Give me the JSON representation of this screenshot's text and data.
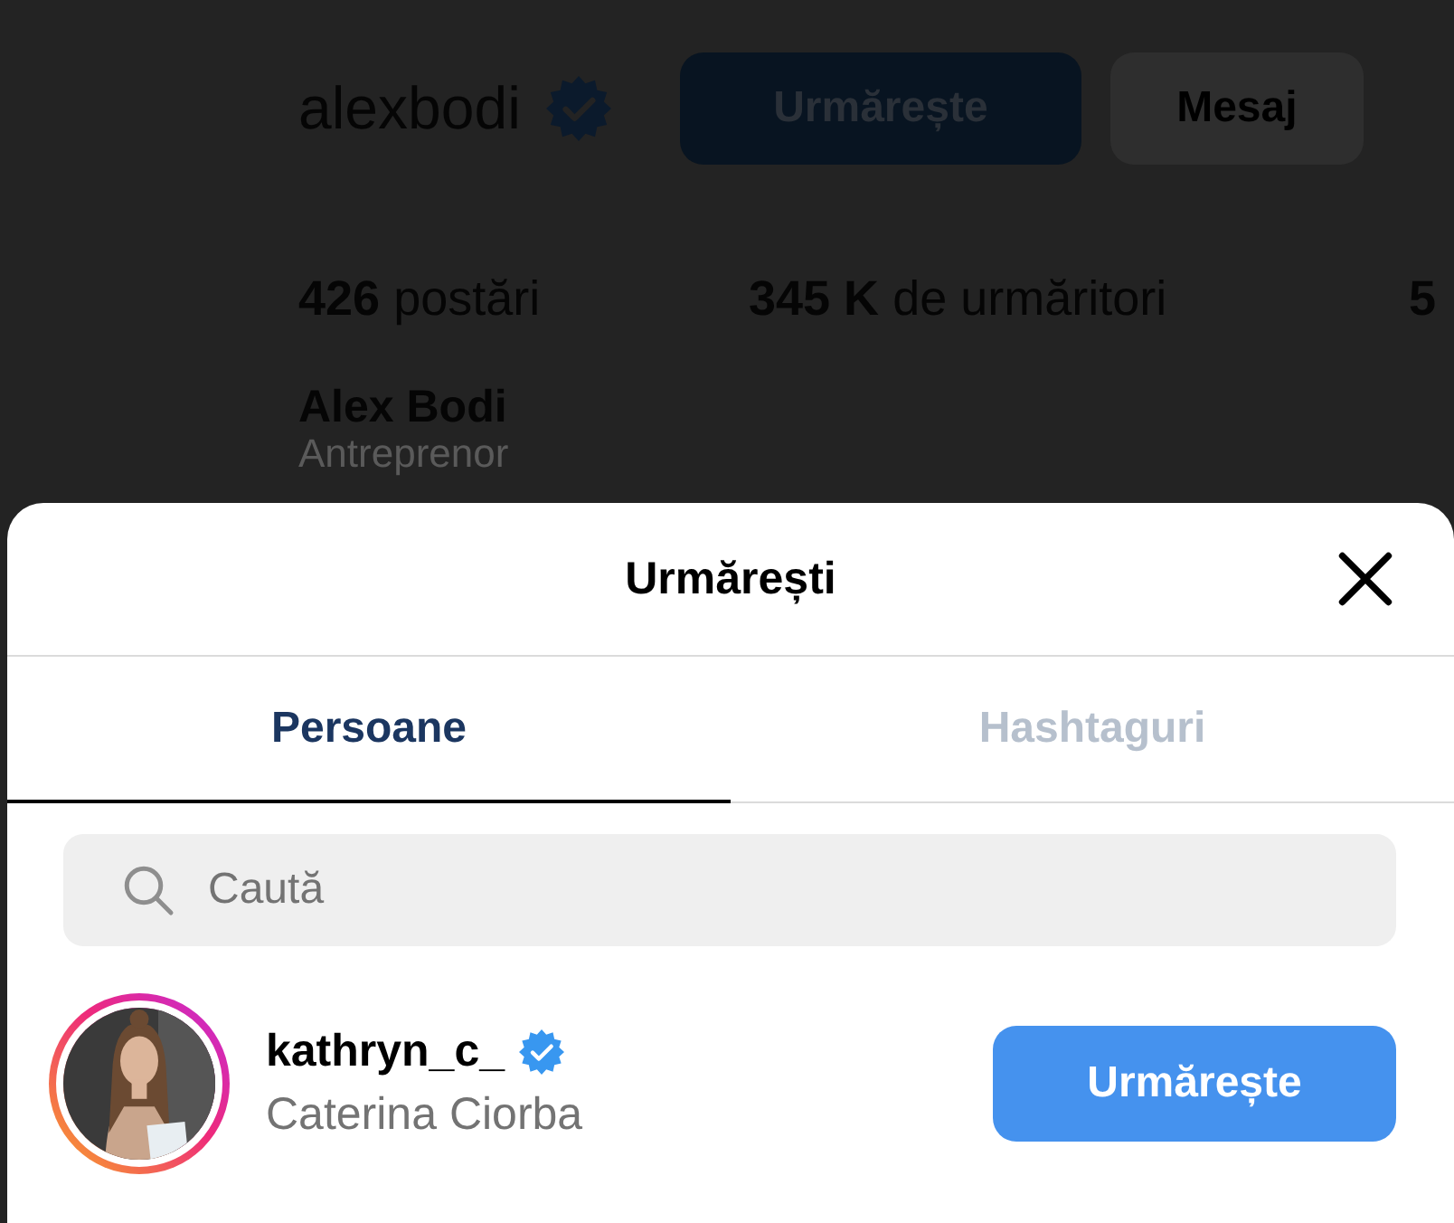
{
  "profile": {
    "username": "alexbodi",
    "verified": true,
    "follow_button": "Urmărește",
    "message_button": "Mesaj",
    "stats": [
      {
        "count": "426",
        "label": "postări"
      },
      {
        "count": "345 K",
        "label": "de urmăritori"
      },
      {
        "count": "5"
      }
    ],
    "full_name": "Alex Bodi",
    "bio": "Antreprenor"
  },
  "dialog": {
    "title": "Urmărești",
    "tabs": [
      {
        "label": "Persoane",
        "selected": true
      },
      {
        "label": "Hashtaguri",
        "selected": false
      }
    ],
    "search": {
      "placeholder": "Caută"
    },
    "accounts": [
      {
        "username": "kathryn_c_",
        "verified": true,
        "name": "Caterina Ciorba",
        "button": "Urmărește"
      }
    ]
  }
}
